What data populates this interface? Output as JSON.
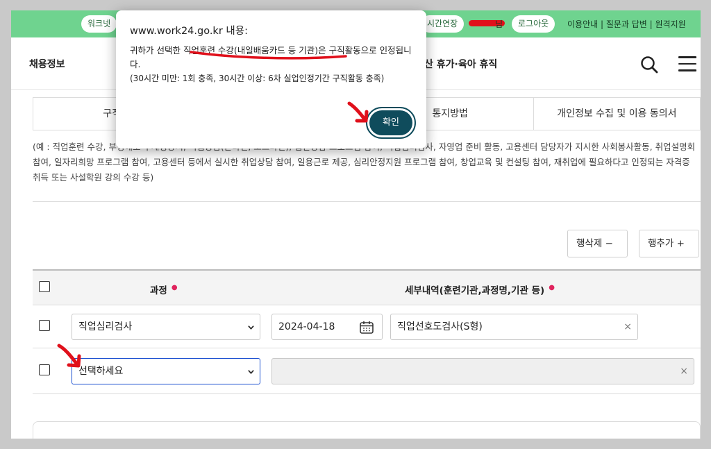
{
  "topbar": {
    "pill_worknet": "워크넷",
    "pill_extend": "시간연장",
    "user_suffix": "님",
    "pill_logout": "로그아웃",
    "links": "이용안내 | 질문과 답변 | 원격지원"
  },
  "header": {
    "left_label": "채용정보",
    "right_label": "산 휴가·육아 휴직"
  },
  "tabs": [
    "구직활",
    "",
    "통지방법",
    "개인정보 수집 및 이용 동의서"
  ],
  "description": "(예 : 직업훈련 수강, 부정해보 구제평양서, 직업상담(온라인, 오프라인), 집단상담 프로그램 참여, 직업심리검사, 자영업 준비 활동, 고용센터 담당자가 지시한 사회봉사활동, 취업설명회 참여, 일자리희망 프로그램 참여, 고용센터 등에서 실시한 취업상담 참여, 일용근로 제공, 심리안정지원 프로그램 참여, 창업교육 및 컨설팅 참여, 재취업에 필요하다고 인정되는 자격증 취득 또는 사설학원 강의 수강 등)",
  "buttons": {
    "delete_row": "행삭제",
    "delete_symbol": "−",
    "add_row": "행추가",
    "add_symbol": "+"
  },
  "table": {
    "col_course": "과정",
    "col_detail": "세부내역(훈련기관,과정명,기관 등)",
    "required_mark": "●",
    "rows": [
      {
        "course": "직업심리검사",
        "date": "2024-04-18",
        "detail": "직업선호도검사(S형)"
      },
      {
        "course": "선택하세요",
        "date": "",
        "detail": ""
      }
    ],
    "clear_symbol": "×"
  },
  "dialog": {
    "title": "www.work24.go.kr 내용:",
    "message": "귀하가 선택한 직업훈련 수강(내일배움카드 등 기관)은 구직활동으로 인정됩니다.",
    "note": "(30시간 미만: 1회 충족, 30시간 이상: 6차 실업인정기간 구직활동 충족)",
    "ok_label": "확인"
  },
  "colors": {
    "topbar": "#6fd38f",
    "ok_button": "#0f4c5c",
    "annotation_red": "#e0101b",
    "active_select_border": "#1a4fd0"
  }
}
